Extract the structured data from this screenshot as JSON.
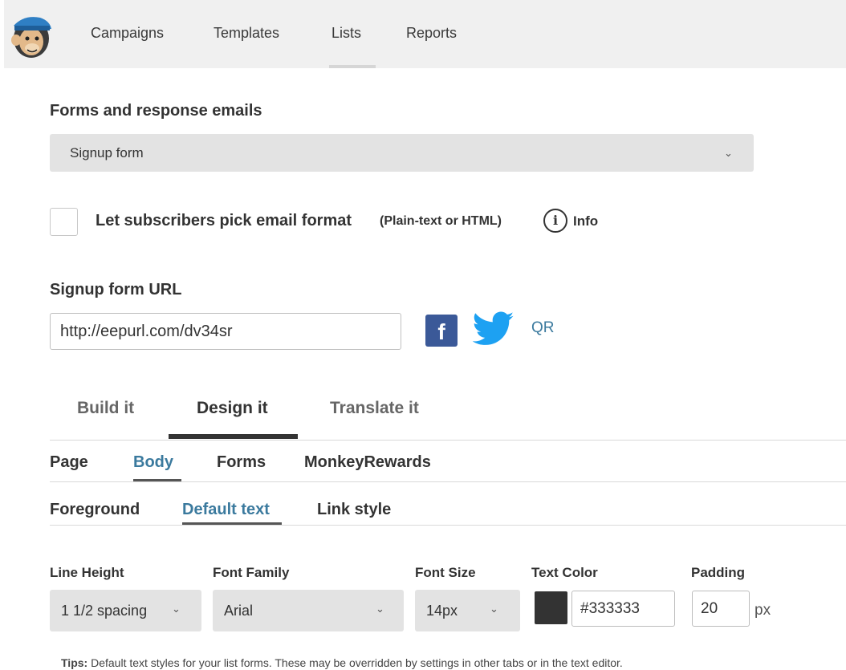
{
  "nav": {
    "items": [
      "Campaigns",
      "Templates",
      "Lists",
      "Reports"
    ],
    "active_index": 2
  },
  "forms_section": {
    "title": "Forms and response emails",
    "selected_form": "Signup form"
  },
  "format_option": {
    "checked": false,
    "label": "Let subscribers pick email format",
    "hint": "(Plain-text or HTML)",
    "info_label": "Info"
  },
  "signup_url": {
    "title": "Signup form URL",
    "value": "http://eepurl.com/dv34sr",
    "qr_label": "QR"
  },
  "main_tabs": {
    "items": [
      "Build it",
      "Design it",
      "Translate it"
    ],
    "active_index": 1
  },
  "design_tabs": {
    "items": [
      "Page",
      "Body",
      "Forms",
      "MonkeyRewards"
    ],
    "active_index": 1
  },
  "body_tabs": {
    "items": [
      "Foreground",
      "Default text",
      "Link style"
    ],
    "active_index": 1
  },
  "text_settings": {
    "line_height_label": "Line Height",
    "line_height_value": "1 1/2 spacing",
    "font_family_label": "Font Family",
    "font_family_value": "Arial",
    "font_size_label": "Font Size",
    "font_size_value": "14px",
    "text_color_label": "Text Color",
    "text_color_value": "#333333",
    "padding_label": "Padding",
    "padding_value": "20",
    "padding_unit": "px"
  },
  "tips": {
    "prefix": "Tips:",
    "text": "Default text styles for your list forms. These may be overridden by settings in other tabs or in the text editor."
  },
  "colors": {
    "accent_link": "#3b7a9e",
    "facebook": "#3b5998",
    "twitter": "#1da1f2",
    "swatch": "#333333"
  }
}
